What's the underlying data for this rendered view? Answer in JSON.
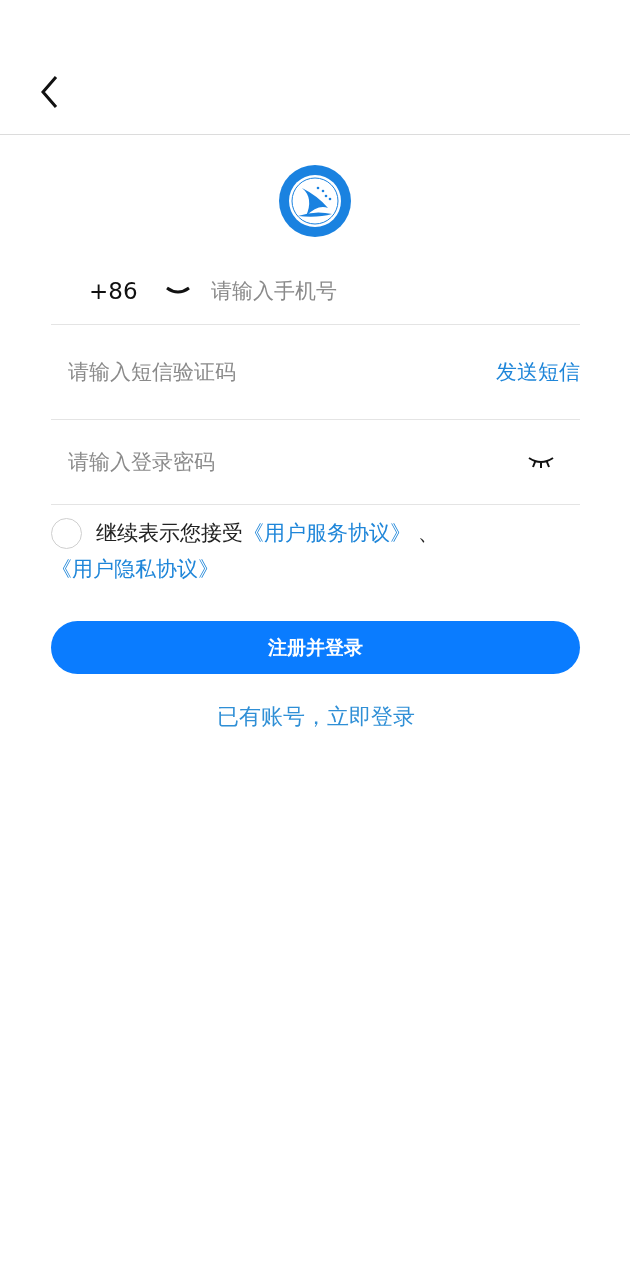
{
  "phone": {
    "country_code": "+86",
    "placeholder": "请输入手机号"
  },
  "sms_code": {
    "placeholder": "请输入短信验证码",
    "send_button": "发送短信"
  },
  "password": {
    "placeholder": "请输入登录密码",
    "visible": false
  },
  "agreement": {
    "checked": false,
    "text": "继续表示您接受",
    "links": [
      "《用户服务协议》",
      "《用户隐私协议》"
    ],
    "separator": "、"
  },
  "submit_button": "注册并登录",
  "login_link": "已有账号，立即登录"
}
